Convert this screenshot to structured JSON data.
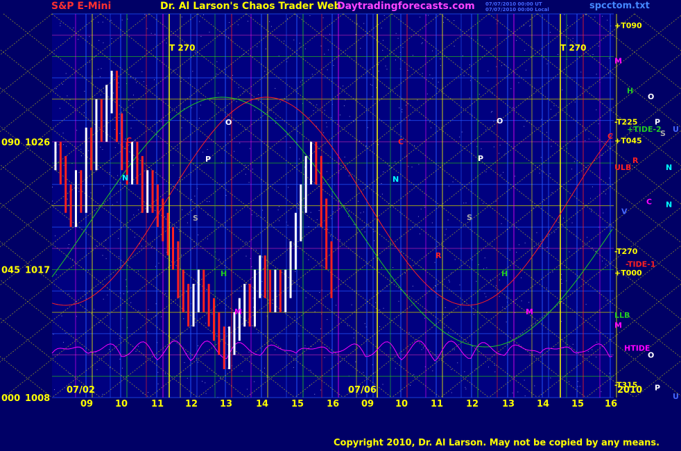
{
  "header": {
    "symbol": "S&P E-Mini",
    "title": "Dr. Al Larson's Chaos Trader Web",
    "site": "Daytradingforecasts.com",
    "time1": "07/07/2010 00:00 UT",
    "time2": "07/07/2010 00:00 Local",
    "file": "spcctom.txt"
  },
  "copyright": "Copyright 2010, Dr. Al Larson. May not be copied by any means.",
  "colors": {
    "background": "#000066",
    "plot_background": "#000080",
    "red": "#ff2020",
    "green": "#22cc22",
    "magenta": "#ff00ff",
    "yellow": "#ffff00",
    "white": "#ffffff",
    "cyan": "#00ffff"
  },
  "chart_data": {
    "type": "line",
    "ylim": [
      1008,
      1035
    ],
    "y_ticks": [
      {
        "left": "090",
        "price": "1026",
        "value": 1026
      },
      {
        "left": "045",
        "price": "1017",
        "value": 1017
      },
      {
        "left": "000",
        "price": "1008",
        "value": 1008
      }
    ],
    "date_labels": [
      "07/02",
      "07/06",
      "2010"
    ],
    "hour_labels": [
      "09",
      "10",
      "11",
      "12",
      "13",
      "14",
      "15",
      "16",
      "09",
      "10",
      "11",
      "12",
      "13",
      "14",
      "15",
      "16"
    ],
    "top_labels": [
      "T  270",
      "T  270"
    ],
    "right_labels": [
      {
        "text": "+T090",
        "color": "yellow",
        "value": 1034.2
      },
      {
        "text": "M",
        "color": "magenta",
        "value": 1031.7
      },
      {
        "text": "H",
        "color": "green",
        "value": 1029.6
      },
      {
        "text": "O",
        "color": "white",
        "value": 1029.2
      },
      {
        "text": "-T225",
        "color": "yellow",
        "value": 1027.4
      },
      {
        "text": "P",
        "color": "white",
        "value": 1027.4
      },
      {
        "text": "+TIDE-2",
        "color": "green",
        "value": 1026.9
      },
      {
        "text": "U",
        "color": "blue",
        "value": 1026.9
      },
      {
        "text": "S",
        "color": "gray",
        "value": 1026.6
      },
      {
        "text": "C",
        "color": "red",
        "value": 1026.4
      },
      {
        "text": "+T045",
        "color": "yellow",
        "value": 1026.1
      },
      {
        "text": "R",
        "color": "red",
        "value": 1024.7
      },
      {
        "text": "ULB",
        "color": "red",
        "value": 1024.2
      },
      {
        "text": "N",
        "color": "cyan",
        "value": 1024.2
      },
      {
        "text": "C",
        "color": "magenta",
        "value": 1021.8
      },
      {
        "text": "N",
        "color": "cyan",
        "value": 1021.6
      },
      {
        "text": "V",
        "color": "blue",
        "value": 1021.1
      },
      {
        "text": "-T270",
        "color": "yellow",
        "value": 1018.3
      },
      {
        "text": "-TIDE-1",
        "color": "red",
        "value": 1017.4
      },
      {
        "text": "+T000",
        "color": "yellow",
        "value": 1016.8
      },
      {
        "text": "LLB",
        "color": "green",
        "value": 1013.8
      },
      {
        "text": "M",
        "color": "magenta",
        "value": 1013.1
      },
      {
        "text": "HTIDE",
        "color": "magenta",
        "value": 1011.5
      },
      {
        "text": "O",
        "color": "white",
        "value": 1011.0
      },
      {
        "text": "-T315",
        "color": "yellow",
        "value": 1008.9
      },
      {
        "text": "P",
        "color": "white",
        "value": 1008.7
      },
      {
        "text": "U",
        "color": "blue",
        "value": 1008.1
      }
    ],
    "plot_letters": [
      {
        "text": "O",
        "color": "white",
        "x": 325,
        "y": 180
      },
      {
        "text": "P",
        "color": "white",
        "x": 296,
        "y": 233
      },
      {
        "text": "C",
        "color": "red",
        "x": 182,
        "y": 206
      },
      {
        "text": "N",
        "color": "cyan",
        "x": 176,
        "y": 260
      },
      {
        "text": "S",
        "color": "gray",
        "x": 278,
        "y": 318
      },
      {
        "text": "H",
        "color": "green",
        "x": 318,
        "y": 398
      },
      {
        "text": "M",
        "color": "magenta",
        "x": 338,
        "y": 453
      },
      {
        "text": "C",
        "color": "red",
        "x": 574,
        "y": 208
      },
      {
        "text": "N",
        "color": "cyan",
        "x": 566,
        "y": 262
      },
      {
        "text": "O",
        "color": "white",
        "x": 716,
        "y": 178
      },
      {
        "text": "P",
        "color": "white",
        "x": 689,
        "y": 232
      },
      {
        "text": "S",
        "color": "gray",
        "x": 673,
        "y": 317
      },
      {
        "text": "R",
        "color": "red",
        "x": 628,
        "y": 372
      },
      {
        "text": "H",
        "color": "green",
        "x": 723,
        "y": 398
      },
      {
        "text": "M",
        "color": "magenta",
        "x": 758,
        "y": 453
      }
    ],
    "price_bars": [
      1025,
      1024,
      1022,
      1021,
      1023,
      1022,
      1026,
      1025,
      1028,
      1027,
      1029,
      1030,
      1027,
      1025,
      1024,
      1025,
      1024,
      1022,
      1023,
      1022,
      1021,
      1020,
      1019,
      1018,
      1016,
      1015,
      1014,
      1015,
      1016,
      1015,
      1014,
      1013,
      1012,
      1011,
      1012,
      1013,
      1014,
      1015,
      1014,
      1016,
      1017,
      1016,
      1015,
      1016,
      1015,
      1016,
      1018,
      1020,
      1022,
      1024,
      1025,
      1024,
      1021,
      1018,
      1016
    ],
    "series": []
  }
}
